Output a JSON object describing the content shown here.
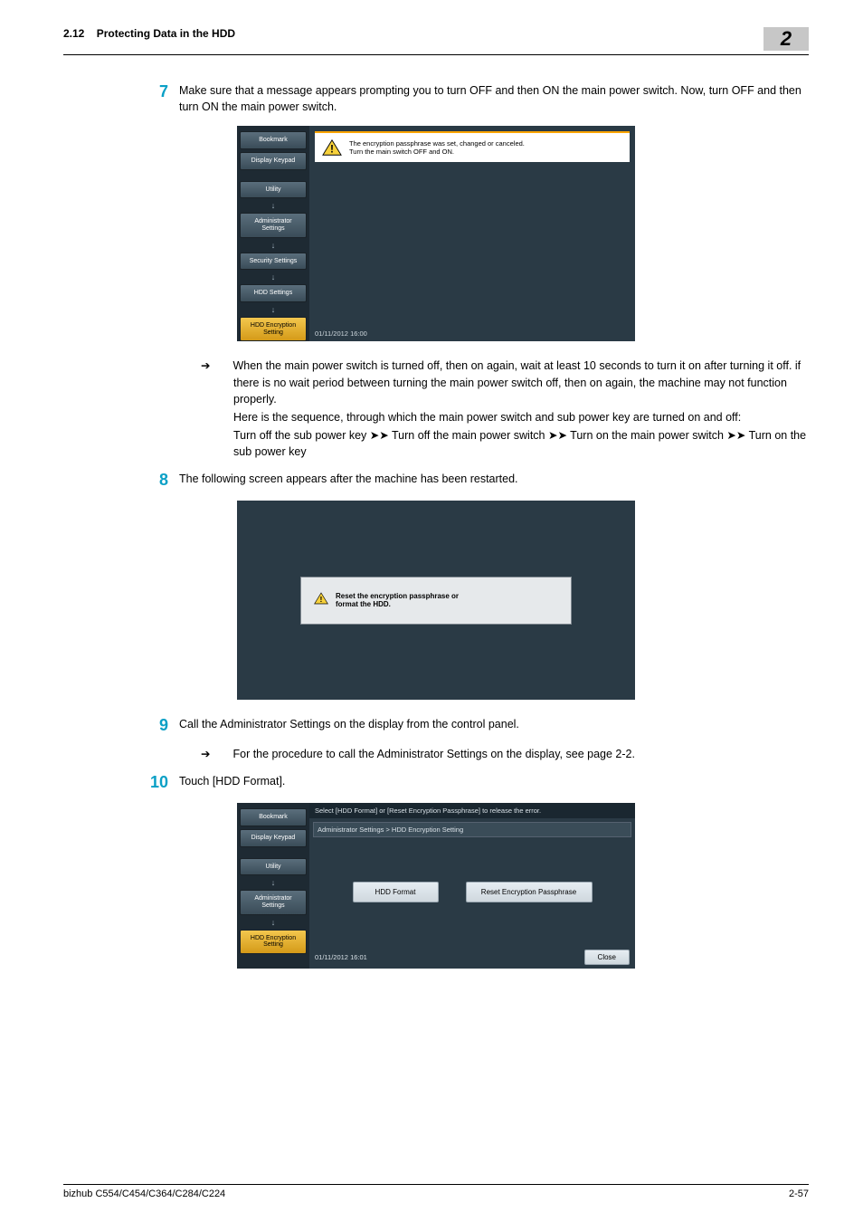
{
  "header": {
    "section_num": "2.12",
    "section_title": "Protecting Data in the HDD",
    "chapter_badge": "2"
  },
  "step7": {
    "num": "7",
    "text": "Make sure that a message appears prompting you to turn OFF and then ON the main power switch. Now, turn OFF and then turn ON the main power switch."
  },
  "screen1": {
    "side": {
      "bookmark": "Bookmark",
      "keypad": "Display Keypad",
      "utility": "Utility",
      "admin": "Administrator Settings",
      "security": "Security Settings",
      "hdd": "HDD Settings",
      "hdd_enc": "HDD Encryption Setting"
    },
    "msg_line1": "The encryption passphrase was set, changed or canceled.",
    "msg_line2": "Turn the main switch OFF and ON.",
    "timestamp": "01/11/2012   16:00"
  },
  "note7": {
    "p1": "When the main power switch is turned off, then on again, wait at least 10 seconds to turn it on after turning it off. if there is no wait period between turning the main power switch off, then on again, the machine may not function properly.",
    "p2": "Here is the sequence, through which the main power switch and sub power key are turned on and off:",
    "p3a": "Turn off the sub power key ",
    "p3b": " Turn off the main power switch ",
    "p3c": " Turn on the main power switch ",
    "p3d": " Turn on the sub power key",
    "arrow": "➤➤"
  },
  "step8": {
    "num": "8",
    "text": "The following screen appears after the machine has been restarted."
  },
  "screen2": {
    "dialog_l1": "Reset the encryption passphrase or",
    "dialog_l2": "format the HDD."
  },
  "step9": {
    "num": "9",
    "text": "Call the Administrator Settings on the display from the control panel.",
    "sub": "For the procedure to call the Administrator Settings on the display, see page 2-2."
  },
  "step10": {
    "num": "10",
    "text": "Touch [HDD Format]."
  },
  "screen3": {
    "top": "Select [HDD Format] or [Reset Encryption Passphrase] to release the error.",
    "crumb": "Administrator Settings > HDD Encryption Setting",
    "side": {
      "bookmark": "Bookmark",
      "keypad": "Display Keypad",
      "utility": "Utility",
      "admin": "Administrator Settings",
      "hdd_enc": "HDD Encryption Setting"
    },
    "btn1": "HDD Format",
    "btn2": "Reset Encryption Passphrase",
    "timestamp": "01/11/2012   16:01",
    "close": "Close"
  },
  "footer": {
    "left": "bizhub C554/C454/C364/C284/C224",
    "right": "2-57"
  }
}
